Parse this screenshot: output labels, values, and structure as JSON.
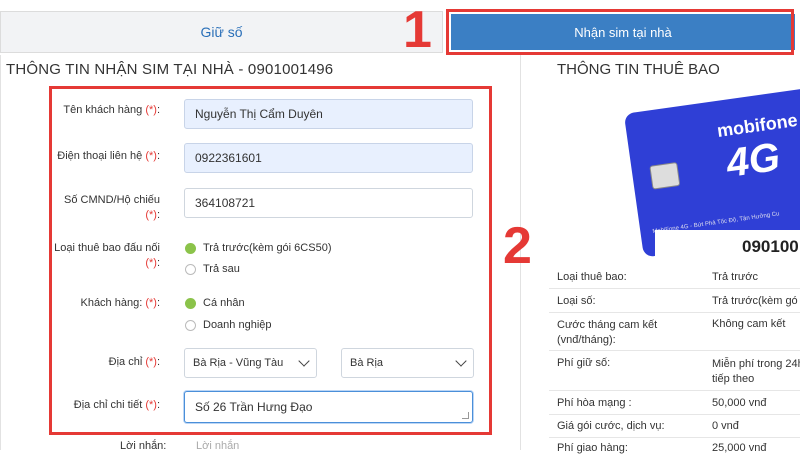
{
  "tabs": {
    "left_label": "Giữ số",
    "right_label": "Nhận sim tại nhà"
  },
  "steps": {
    "one": "1",
    "two": "2"
  },
  "left_heading": "THÔNG TIN NHẬN SIM TẠI NHÀ - 0901001496",
  "right_heading": "THÔNG TIN THUÊ BAO",
  "form": {
    "name_label": "Tên khách hàng",
    "name_value": "Nguyễn Thị Cẩm Duyên",
    "phone_label": "Điện thoại liên hệ",
    "phone_value": "0922361601",
    "id_label_1": "Số CMND/Hộ chiếu",
    "id_value": "364108721",
    "type_label_1": "Loại thuê bao đấu nối",
    "type_opt1": "Trả trước(kèm gói 6CS50)",
    "type_opt2": "Trả sau",
    "customer_label": "Khách hàng:",
    "customer_opt1": "Cá nhân",
    "customer_opt2": "Doanh nghiệp",
    "address_label": "Địa chỉ",
    "province": "Bà Rịa - Vũng Tàu",
    "district": "Bà Rịa",
    "address_detail_label": "Địa chỉ chi tiết",
    "address_detail_value": "Số 26 Trần Hưng Đạo",
    "note_label": "Lời nhắn:",
    "note_placeholder": "Lời nhắn",
    "required_mark": "(*)",
    "colon": ":"
  },
  "sim": {
    "brand": "mobifone",
    "badge": "4G",
    "number_partial": "090100",
    "footer_text": "MobiFone 4G - Bứt Phá Tốc Độ, Tận Hưởng Cu"
  },
  "info": [
    {
      "key": "Loại thuê bao:",
      "value": "Trả trước"
    },
    {
      "key": "Loại số:",
      "value": "Trả trước(kèm gó"
    },
    {
      "key": "Cước tháng cam kết (vnđ/tháng):",
      "value": "Không cam kết"
    },
    {
      "key": "Phí giữ số:",
      "value": "Miễn phí trong 24h tiếp theo"
    },
    {
      "key": "Phí hòa mạng :",
      "value": "50,000 vnđ"
    },
    {
      "key": "Giá gói cước, dịch vụ:",
      "value": "0 vnđ"
    },
    {
      "key": "Phí giao hàng:",
      "value": "25,000 vnđ"
    }
  ],
  "colors": {
    "accent_red": "#e53935",
    "tab_blue": "#3b7fc4",
    "radio_green": "#8bc34a",
    "sim_blue": "#2f3fd6"
  }
}
